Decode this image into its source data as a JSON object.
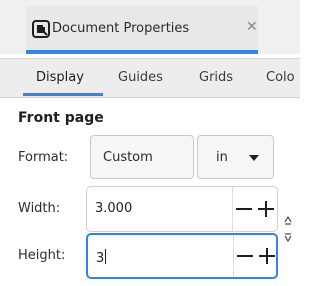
{
  "panel": {
    "title": "Document Properties",
    "icons": {
      "document": "document-properties-icon",
      "close": "close-icon"
    }
  },
  "tabs": [
    {
      "label": "Display",
      "active": true
    },
    {
      "label": "Guides",
      "active": false
    },
    {
      "label": "Grids",
      "active": false
    },
    {
      "label": "Colo",
      "active": false
    }
  ],
  "front_page": {
    "heading": "Front page",
    "format_label": "Format:",
    "format_value": "Custom",
    "unit_value": "in",
    "width_label": "Width:",
    "width_value": "3.000",
    "height_label": "Height:",
    "height_value": "3",
    "link_icon": "chain-link-icon"
  },
  "colors": {
    "accent": "#3584e4",
    "tab_bg": "#ededed"
  }
}
